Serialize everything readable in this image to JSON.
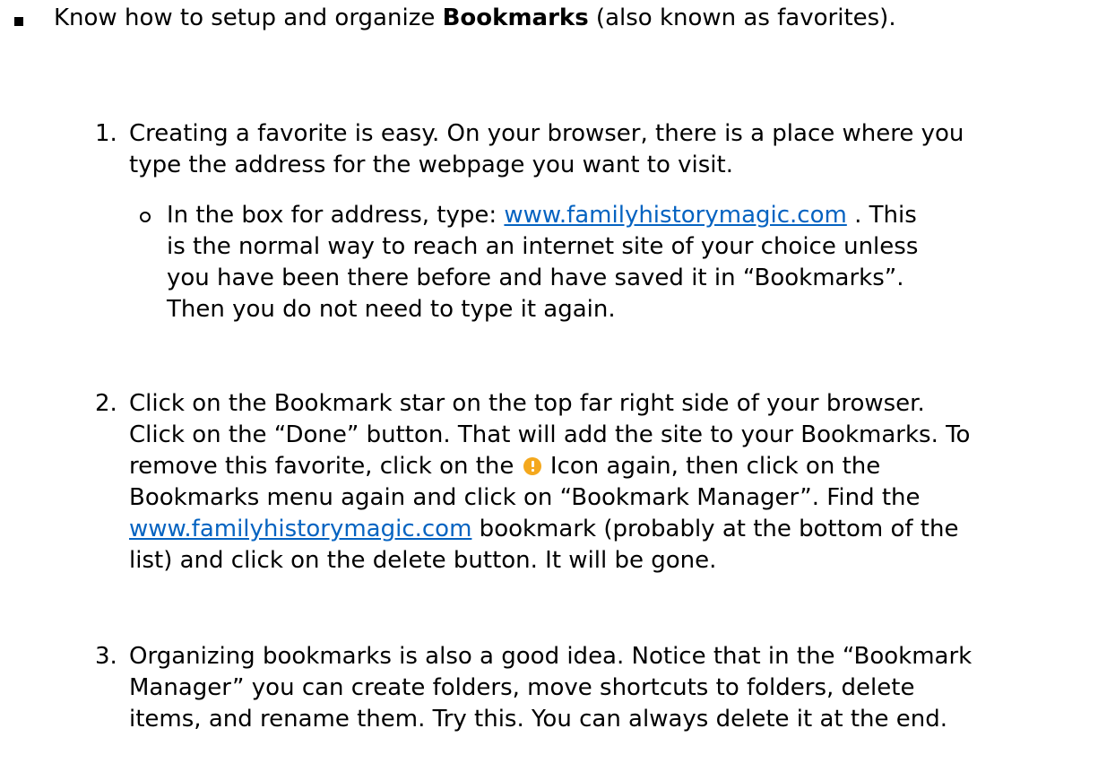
{
  "intro": {
    "pre": "Know how to setup and organize ",
    "bold": "Bookmarks",
    "post": " (also known as favorites)."
  },
  "step1": {
    "number": "1.",
    "line1": "Creating a favorite is easy.  On your browser, there is a place where you",
    "line2": "type the address for the webpage you want to visit.",
    "sub": {
      "pre": "In the box for address, type: ",
      "link": "www.familyhistorymagic.com",
      "post": " .  This",
      "line2": "is the normal way to reach an internet site of your choice unless",
      "line3": "you have been there before and have saved it in “Bookmarks”.",
      "line4": "Then you do not need to type it again."
    }
  },
  "step2": {
    "number": "2.",
    "line1": "Click on the Bookmark star on the top far right side of your browser.",
    "line2": "Click on the “Done” button.  That will add the site to your Bookmarks. To",
    "line3_pre": "remove this favorite, click on the ",
    "line3_post": " Icon again, then click on the",
    "line4": "Bookmarks menu again and click on “Bookmark Manager”.  Find the",
    "line5_link": "www.familyhistorymagic.com",
    "line5_post": " bookmark (probably at the bottom of the",
    "line6": "list) and click on the delete button.  It will be gone."
  },
  "step3": {
    "number": "3.",
    "line1": "Organizing bookmarks is also a good idea.  Notice that in the “Bookmark",
    "line2": "Manager” you can create folders, move shortcuts to folders, delete",
    "line3": "items, and rename them.  Try this.  You can always delete it at the end."
  },
  "colors": {
    "link": "#0563c1",
    "icon": "#f4a81d"
  },
  "icons": {
    "inline_icon": "warning-icon"
  }
}
